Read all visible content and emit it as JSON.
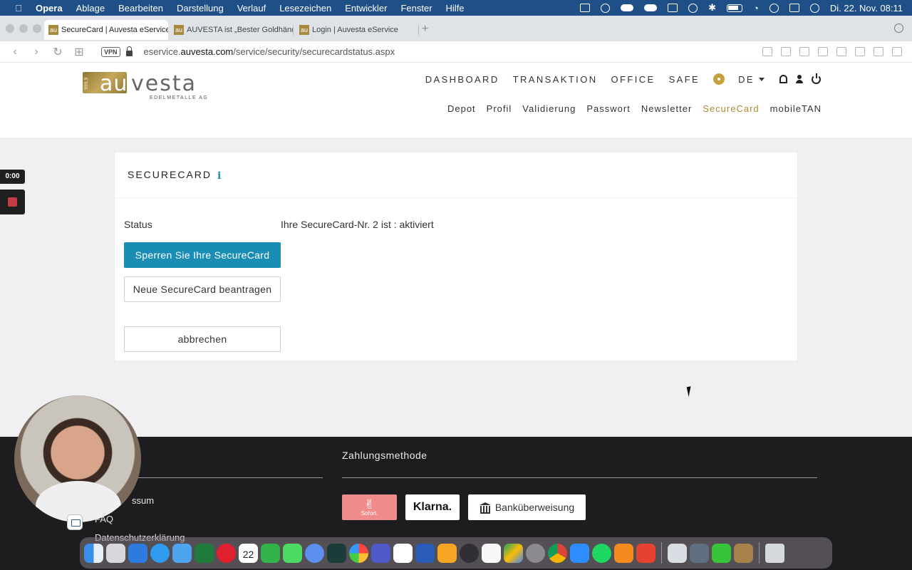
{
  "menubar": {
    "app_name": "Opera",
    "items": [
      "Ablage",
      "Bearbeiten",
      "Darstellung",
      "Verlauf",
      "Lesezeichen",
      "Entwickler",
      "Fenster",
      "Hilfe"
    ],
    "clock": "Di. 22. Nov.  08:11"
  },
  "browser": {
    "tabs": [
      {
        "title": "SecureCard | Auvesta eService",
        "active": true
      },
      {
        "title": "AUVESTA ist „Bester Goldhändl",
        "active": false
      },
      {
        "title": "Login | Auvesta eService",
        "active": false
      }
    ],
    "new_tab": "+",
    "vpn_label": "VPN",
    "url_prefix": "eservice.",
    "url_domain": "auvesta.com",
    "url_path": "/service/security/securecardstatus.aspx"
  },
  "site": {
    "logo": {
      "mark": "au",
      "word": "vesta",
      "subtitle": "EDELMETALLE AG",
      "purity": "999,9"
    },
    "main_nav": [
      "DASHBOARD",
      "TRANSAKTION",
      "OFFICE",
      "SAFE"
    ],
    "language": "DE",
    "sub_nav": [
      {
        "label": "Depot",
        "active": false
      },
      {
        "label": "Profil",
        "active": false
      },
      {
        "label": "Validierung",
        "active": false
      },
      {
        "label": "Passwort",
        "active": false
      },
      {
        "label": "Newsletter",
        "active": false
      },
      {
        "label": "SecureCard",
        "active": true
      },
      {
        "label": "mobileTAN",
        "active": false
      }
    ],
    "accent_color": "#1a8db4",
    "gold_color": "#b08a36"
  },
  "recorder": {
    "timer": "0:00"
  },
  "card": {
    "title": "SECURECARD",
    "info_icon": "i",
    "status_label": "Status",
    "status_value": "Ihre SecureCard-Nr. 2 ist : aktiviert",
    "lock_button": "Sperren Sie Ihre SecureCard",
    "new_button": "Neue SecureCard beantragen",
    "cancel_button": "abbrechen"
  },
  "footer": {
    "payment_title": "Zahlungsmethode",
    "links": [
      "ssum",
      "FAQ",
      "Datenschutzerklärung"
    ],
    "payments": {
      "sofort": "Sofort.",
      "klarna": "Klarna.",
      "bank": "Banküberweisung"
    }
  },
  "dock": {
    "apps": [
      "finder",
      "launchpad",
      "keynote",
      "safari",
      "mail",
      "excel",
      "opera",
      "calendar",
      "numbers",
      "messages",
      "settings-flower",
      "robinhood",
      "photos",
      "teams",
      "slack",
      "word",
      "pages",
      "obs",
      "drive",
      "google-drive",
      "system-preferences",
      "chrome",
      "zoom",
      "spotify",
      "vlc",
      "todoist",
      "preview",
      "quicktime",
      "terminal",
      "archive",
      "trash"
    ],
    "calendar_day": "22"
  }
}
